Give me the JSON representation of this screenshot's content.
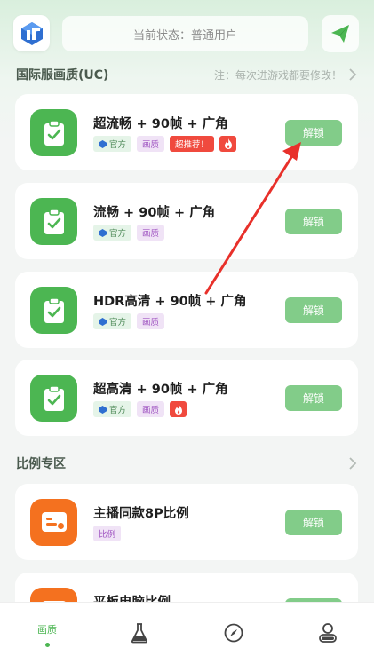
{
  "header": {
    "status_text": "当前状态：普通用户"
  },
  "section1": {
    "title": "国际服画质(UC)",
    "note": "注：每次进游戏都要修改！"
  },
  "section2": {
    "title": "比例专区"
  },
  "cards": [
    {
      "title": "超流畅 + 90帧 + 广角",
      "tags": [
        "官方",
        "画质",
        "超推荐！"
      ],
      "button": "解锁"
    },
    {
      "title": "流畅 + 90帧 + 广角",
      "tags": [
        "官方",
        "画质"
      ],
      "button": "解锁"
    },
    {
      "title": "HDR高清 + 90帧 + 广角",
      "tags": [
        "官方",
        "画质"
      ],
      "button": "解锁"
    },
    {
      "title": "超高清 + 90帧 + 广角",
      "tags": [
        "官方",
        "画质"
      ],
      "button": "解锁"
    }
  ],
  "ratio_cards": [
    {
      "title": "主播同款8P比例",
      "tags": [
        "比例"
      ],
      "button": "解锁"
    },
    {
      "title": "平板电脑比例",
      "button": "解锁"
    }
  ],
  "nav": {
    "active_label": "画质"
  },
  "colors": {
    "accent_green": "#4cb652",
    "unlock_button": "#82cc89",
    "orange_icon": "#f4711f",
    "hot_red": "#f04a3e",
    "annotation_arrow": "#e8302a"
  },
  "icons": {
    "logo": "app-logo-icon",
    "send": "paper-plane-icon",
    "card_green": "clipboard-check-icon",
    "card_orange": "ratio-card-icon",
    "hot": "flame-icon",
    "nav": [
      "quality-tab",
      "flask-icon",
      "compass-icon",
      "user-icon"
    ]
  }
}
